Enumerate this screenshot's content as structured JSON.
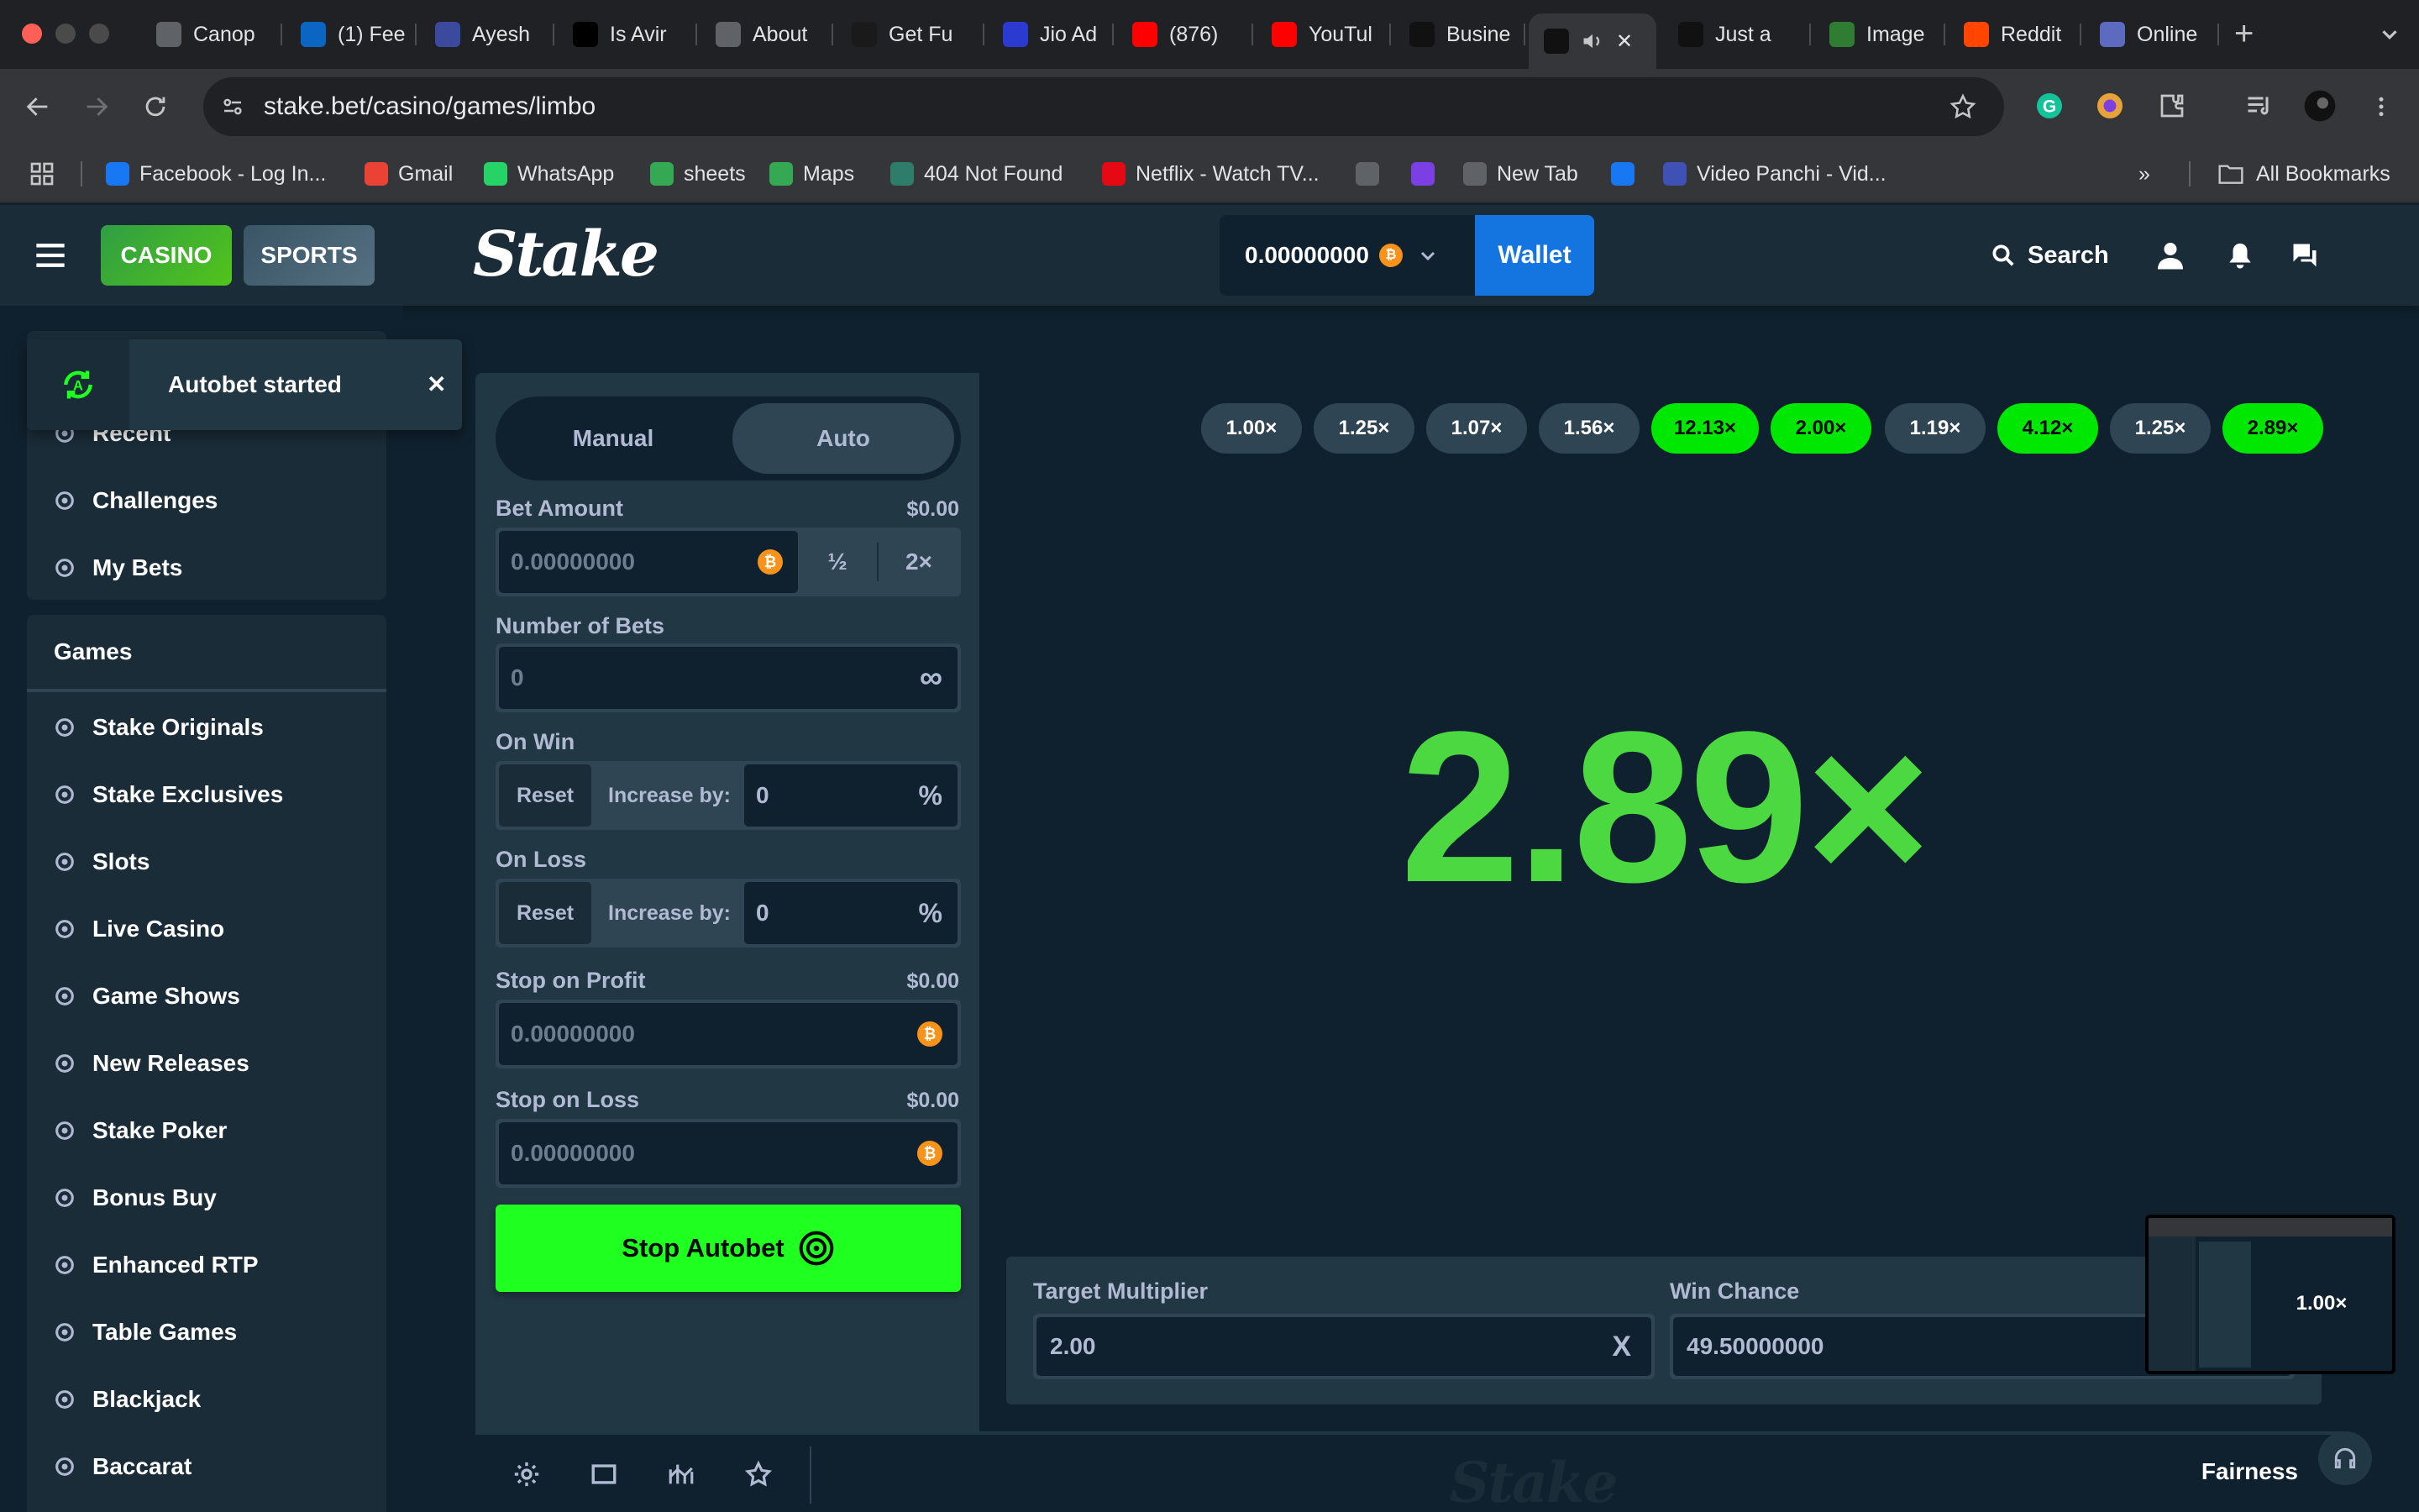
{
  "browser": {
    "tabs": [
      {
        "label": "Canop",
        "icon": "canopy-icon",
        "color": "#5f6368"
      },
      {
        "label": "(1) Fee",
        "icon": "linkedin-icon",
        "color": "#0a66c2"
      },
      {
        "label": "Ayesh",
        "icon": "ai-icon",
        "color": "#3c4a9e"
      },
      {
        "label": "Is Avir",
        "icon": "medium-icon",
        "color": "#000000"
      },
      {
        "label": "About",
        "icon": "about-icon",
        "color": "#5f6368"
      },
      {
        "label": "Get Fu",
        "icon": "pv-icon",
        "color": "#1a1a1a"
      },
      {
        "label": "Jio Ad",
        "icon": "jio-icon",
        "color": "#2b3bd1"
      },
      {
        "label": "(876)",
        "icon": "youtube-icon",
        "color": "#ff0000"
      },
      {
        "label": "YouTul",
        "icon": "youtube-music-icon",
        "color": "#ff0000"
      },
      {
        "label": "Busine",
        "icon": "r-icon",
        "color": "#111111"
      },
      {
        "label": "",
        "icon": "stake-icon",
        "color": "#111111",
        "active": true
      },
      {
        "label": "Just a",
        "icon": "stake-icon",
        "color": "#111111"
      },
      {
        "label": "Image",
        "icon": "image-icon",
        "color": "#2e7d32"
      },
      {
        "label": "Reddit",
        "icon": "reddit-icon",
        "color": "#ff4500"
      },
      {
        "label": "Online",
        "icon": "online-icon",
        "color": "#5c6bc0"
      }
    ],
    "url": "stake.bet/casino/games/limbo",
    "bookmarks": [
      {
        "label": "Facebook - Log In...",
        "icon": "facebook-icon",
        "color": "#1877f2"
      },
      {
        "label": "Gmail",
        "icon": "gmail-icon",
        "color": "#ea4335"
      },
      {
        "label": "WhatsApp",
        "icon": "whatsapp-icon",
        "color": "#25d366"
      },
      {
        "label": "sheets",
        "icon": "drive-icon",
        "color": "#34a853"
      },
      {
        "label": "Maps",
        "icon": "maps-icon",
        "color": "#34a853"
      },
      {
        "label": "404 Not Found",
        "icon": "globe-green-icon",
        "color": "#2e7d6b"
      },
      {
        "label": "Netflix - Watch TV...",
        "icon": "netflix-icon",
        "color": "#e50914"
      },
      {
        "label": "",
        "icon": "globe-icon",
        "color": "#5f6368"
      },
      {
        "label": "",
        "icon": "star-purple-icon",
        "color": "#7b3fe4"
      },
      {
        "label": "New Tab",
        "icon": "globe-icon",
        "color": "#5f6368"
      },
      {
        "label": "",
        "icon": "facebook-icon",
        "color": "#1877f2"
      },
      {
        "label": "Video Panchi - Vid...",
        "icon": "c-icon",
        "color": "#3f51b5"
      }
    ],
    "all_bookmarks": "All Bookmarks",
    "more": "»"
  },
  "header": {
    "casino": "CASINO",
    "sports": "SPORTS",
    "logo": "Stake",
    "balance": "0.00000000",
    "currency_symbol": "₿",
    "wallet": "Wallet",
    "search": "Search"
  },
  "toast": {
    "text": "Autobet started",
    "close": "✕"
  },
  "sidebar": {
    "top_items": [
      {
        "label": "Recent",
        "icon": "recent-icon"
      },
      {
        "label": "Challenges",
        "icon": "challenges-icon"
      },
      {
        "label": "My Bets",
        "icon": "my-bets-icon"
      }
    ],
    "games_heading": "Games",
    "game_items": [
      {
        "label": "Stake Originals",
        "icon": "flame-icon"
      },
      {
        "label": "Stake Exclusives",
        "icon": "bookmark-star-icon"
      },
      {
        "label": "Slots",
        "icon": "slots-icon"
      },
      {
        "label": "Live Casino",
        "icon": "live-casino-icon"
      },
      {
        "label": "Game Shows",
        "icon": "gift-icon"
      },
      {
        "label": "New Releases",
        "icon": "rocket-icon"
      },
      {
        "label": "Stake Poker",
        "icon": "poker-chip-icon"
      },
      {
        "label": "Bonus Buy",
        "icon": "bonus-buy-icon"
      },
      {
        "label": "Enhanced RTP",
        "icon": "enhanced-rtp-icon"
      },
      {
        "label": "Table Games",
        "icon": "table-games-icon"
      },
      {
        "label": "Blackjack",
        "icon": "blackjack-icon"
      },
      {
        "label": "Baccarat",
        "icon": "baccarat-icon"
      }
    ]
  },
  "controls": {
    "tab_manual": "Manual",
    "tab_auto": "Auto",
    "bet_amount_label": "Bet Amount",
    "bet_amount_usd": "$0.00",
    "bet_amount_value": "0.00000000",
    "half": "½",
    "double": "2×",
    "num_bets_label": "Number of Bets",
    "num_bets_value": "0",
    "infinity": "∞",
    "on_win_label": "On Win",
    "on_loss_label": "On Loss",
    "reset": "Reset",
    "increase_by": "Increase by:",
    "on_win_value": "0",
    "on_loss_value": "0",
    "percent": "%",
    "stop_profit_label": "Stop on Profit",
    "stop_profit_usd": "$0.00",
    "stop_profit_value": "0.00000000",
    "stop_loss_label": "Stop on Loss",
    "stop_loss_usd": "$0.00",
    "stop_loss_value": "0.00000000",
    "stop_autobet": "Stop Autobet"
  },
  "game": {
    "history": [
      {
        "value": "1.00×",
        "win": false
      },
      {
        "value": "1.25×",
        "win": false
      },
      {
        "value": "1.07×",
        "win": false
      },
      {
        "value": "1.56×",
        "win": false
      },
      {
        "value": "12.13×",
        "win": true
      },
      {
        "value": "2.00×",
        "win": true
      },
      {
        "value": "1.19×",
        "win": false
      },
      {
        "value": "4.12×",
        "win": true
      },
      {
        "value": "1.25×",
        "win": false
      },
      {
        "value": "2.89×",
        "win": true
      }
    ],
    "result": "2.89×",
    "result_color": "#4bd840",
    "target_multiplier_label": "Target Multiplier",
    "target_multiplier_value": "2.00",
    "clear": "X",
    "win_chance_label": "Win Chance",
    "win_chance_value": "49.50000000",
    "pip_value": "1.00×",
    "fairness": "Fairness",
    "watermark": "Stake"
  }
}
